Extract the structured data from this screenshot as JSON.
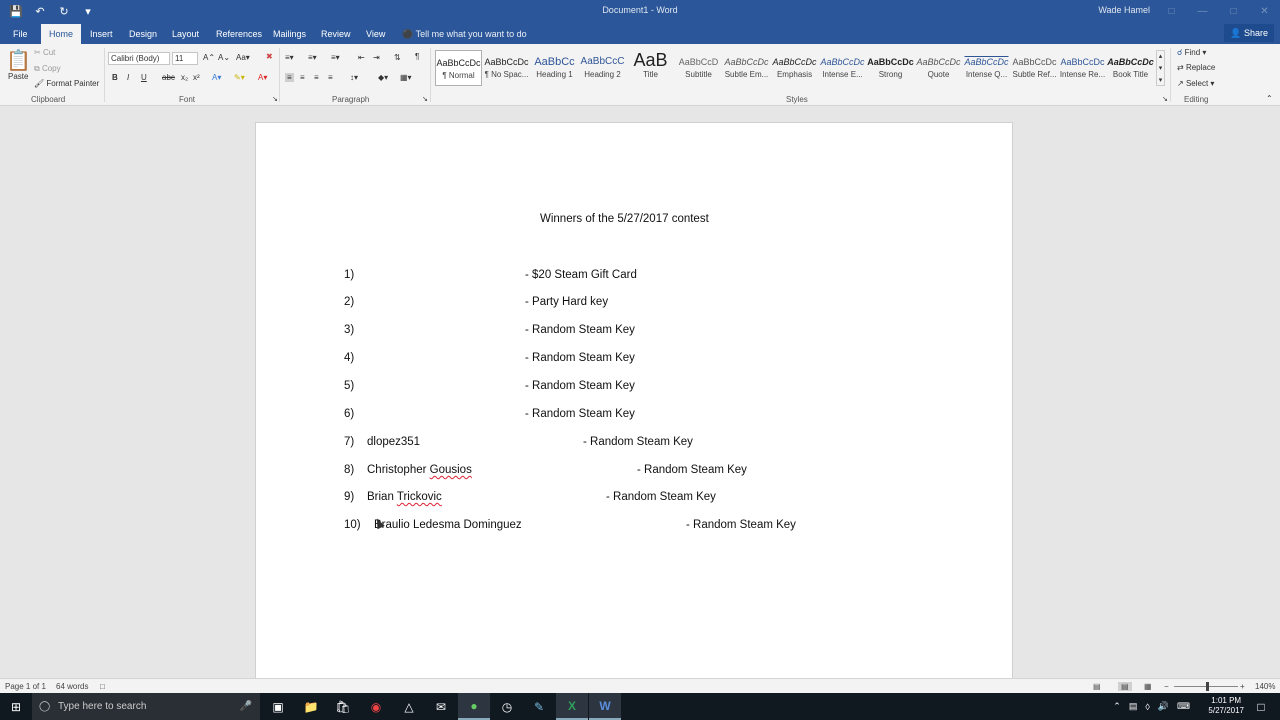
{
  "window": {
    "title": "Document1  -  Word",
    "user": "Wade Hamel"
  },
  "tabs": [
    "File",
    "Home",
    "Insert",
    "Design",
    "Layout",
    "References",
    "Mailings",
    "Review",
    "View"
  ],
  "tell_me": "Tell me what you want to do",
  "share": "Share",
  "ribbon": {
    "clipboard": {
      "paste": "Paste",
      "cut": "Cut",
      "copy": "Copy",
      "format_painter": "Format Painter",
      "label": "Clipboard"
    },
    "font": {
      "name": "Calibri (Body)",
      "size": "11",
      "label": "Font"
    },
    "paragraph": {
      "label": "Paragraph"
    },
    "styles": {
      "label": "Styles",
      "items": [
        {
          "sample": "AaBbCcDc",
          "name": "¶ Normal"
        },
        {
          "sample": "AaBbCcDc",
          "name": "¶ No Spac..."
        },
        {
          "sample": "AaBbCc",
          "name": "Heading 1"
        },
        {
          "sample": "AaBbCcC",
          "name": "Heading 2"
        },
        {
          "sample": "AaB",
          "name": "Title"
        },
        {
          "sample": "AaBbCcD",
          "name": "Subtitle"
        },
        {
          "sample": "AaBbCcDc",
          "name": "Subtle Em..."
        },
        {
          "sample": "AaBbCcDc",
          "name": "Emphasis"
        },
        {
          "sample": "AaBbCcDc",
          "name": "Intense E..."
        },
        {
          "sample": "AaBbCcDc",
          "name": "Strong"
        },
        {
          "sample": "AaBbCcDc",
          "name": "Quote"
        },
        {
          "sample": "AaBbCcDc",
          "name": "Intense Q..."
        },
        {
          "sample": "AaBbCcDc",
          "name": "Subtle Ref..."
        },
        {
          "sample": "AaBbCcDc",
          "name": "Intense Re..."
        },
        {
          "sample": "AaBbCcDc",
          "name": "Book Title"
        }
      ]
    },
    "editing": {
      "find": "Find",
      "replace": "Replace",
      "select": "Select",
      "label": "Editing"
    }
  },
  "document": {
    "heading": "Winners of the 5/27/2017 contest",
    "lines": [
      {
        "num": "1)",
        "name": "",
        "prize": "-   $20 Steam Gift Card"
      },
      {
        "num": "2)",
        "name": "",
        "prize": "- Party Hard key"
      },
      {
        "num": "3)",
        "name": "",
        "prize": "- Random Steam Key"
      },
      {
        "num": "4)",
        "name": "",
        "prize": "- Random Steam Key"
      },
      {
        "num": "5)",
        "name": "",
        "prize": "- Random Steam Key"
      },
      {
        "num": "6)",
        "name": "",
        "prize": "- Random Steam Key"
      },
      {
        "num": "7)",
        "name": "dlopez351",
        "prize": "- Random Steam Key"
      },
      {
        "num": "8)",
        "name_first": "Christopher ",
        "name_last": "Gousios",
        "prize": "- Random Steam Key"
      },
      {
        "num": "9)",
        "name_first": "Brian ",
        "name_last": "Trickovic",
        "prize": "- Random Steam Key"
      },
      {
        "num": "10)",
        "name": "Braulio Ledesma Dominguez",
        "prize": "- Random Steam Key"
      }
    ]
  },
  "status": {
    "page": "Page 1 of 1",
    "words": "64 words",
    "zoom": "140%"
  },
  "taskbar": {
    "search_placeholder": "Type here to search",
    "time": "1:01 PM",
    "date": "5/27/2017"
  },
  "colors": {
    "accent": "#2b579a"
  }
}
